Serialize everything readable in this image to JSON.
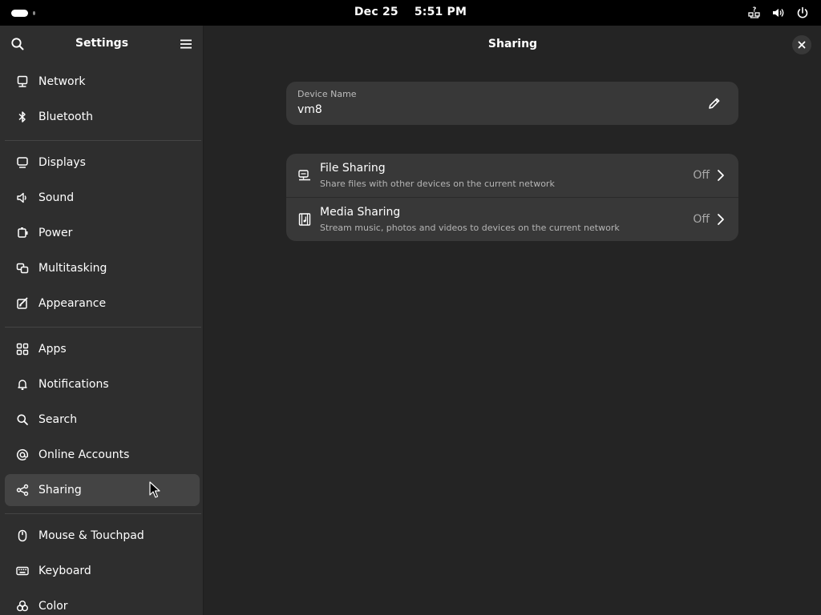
{
  "topbar": {
    "date": "Dec 25",
    "time": "5:51 PM",
    "tray_icons": [
      "network-unknown-icon",
      "volume-icon",
      "power-icon"
    ]
  },
  "sidebar": {
    "title": "Settings",
    "items": [
      {
        "label": "Network",
        "icon": "network-icon"
      },
      {
        "label": "Bluetooth",
        "icon": "bluetooth-icon"
      },
      {
        "label": "Displays",
        "icon": "display-icon"
      },
      {
        "label": "Sound",
        "icon": "speaker-icon"
      },
      {
        "label": "Power",
        "icon": "power-plug-icon"
      },
      {
        "label": "Multitasking",
        "icon": "multitasking-icon"
      },
      {
        "label": "Appearance",
        "icon": "appearance-icon"
      },
      {
        "label": "Apps",
        "icon": "apps-grid-icon"
      },
      {
        "label": "Notifications",
        "icon": "bell-icon"
      },
      {
        "label": "Search",
        "icon": "search-icon"
      },
      {
        "label": "Online Accounts",
        "icon": "at-sign-icon"
      },
      {
        "label": "Sharing",
        "icon": "share-icon"
      },
      {
        "label": "Mouse & Touchpad",
        "icon": "mouse-icon"
      },
      {
        "label": "Keyboard",
        "icon": "keyboard-icon"
      },
      {
        "label": "Color",
        "icon": "color-icon"
      }
    ],
    "selected": "Sharing"
  },
  "content": {
    "title": "Sharing",
    "device": {
      "label": "Device Name",
      "value": "vm8"
    },
    "rows": [
      {
        "title": "File Sharing",
        "subtitle": "Share files with other devices on the current network",
        "state": "Off",
        "icon": "file-sharing-icon"
      },
      {
        "title": "Media Sharing",
        "subtitle": "Stream music, photos and videos to devices on the current network",
        "state": "Off",
        "icon": "media-sharing-icon"
      }
    ]
  },
  "colors": {
    "background": "#242424",
    "sidebar": "#2e2e2e",
    "card": "#383838",
    "selected_row": "#444444",
    "topbar": "#000000"
  }
}
